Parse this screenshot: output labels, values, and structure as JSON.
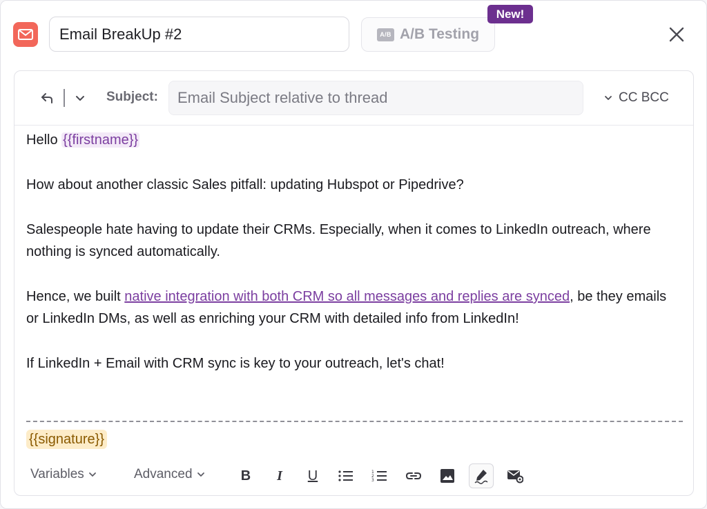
{
  "header": {
    "sequence_name": "Email BreakUp #2",
    "ab_testing_label": "A/B Testing",
    "ab_icon_text": "A/B",
    "new_badge": "New!"
  },
  "compose": {
    "subject_label": "Subject:",
    "subject_placeholder": "Email Subject relative to thread",
    "cc_bcc_label": "CC BCC"
  },
  "body": {
    "greeting": "Hello ",
    "firstname_var": "{{firstname}}",
    "para1": "How about another classic Sales pitfall: updating Hubspot or Pipedrive?",
    "para2": "Salespeople hate having to update their CRMs. Especially, when it comes to LinkedIn outreach, where nothing is synced automatically.",
    "para3_before": "Hence, we built ",
    "para3_link": "native integration with both CRM so all messages and replies are synced",
    "para3_after": ", be they emails or LinkedIn DMs, as well as enriching your CRM with detailed info from LinkedIn!",
    "para4": "If LinkedIn + Email with CRM sync is key to your outreach, let's chat!",
    "signature_var": "{{signature}}"
  },
  "toolbar": {
    "variables_label": "Variables",
    "advanced_label": "Advanced",
    "bold": "B",
    "italic": "I",
    "underline": "U"
  },
  "colors": {
    "brand_purple": "#6c2f8f",
    "variable_purple": "#7b3ea0",
    "mail_icon_red": "#f2675a",
    "signature_bg": "#fdecc8"
  }
}
